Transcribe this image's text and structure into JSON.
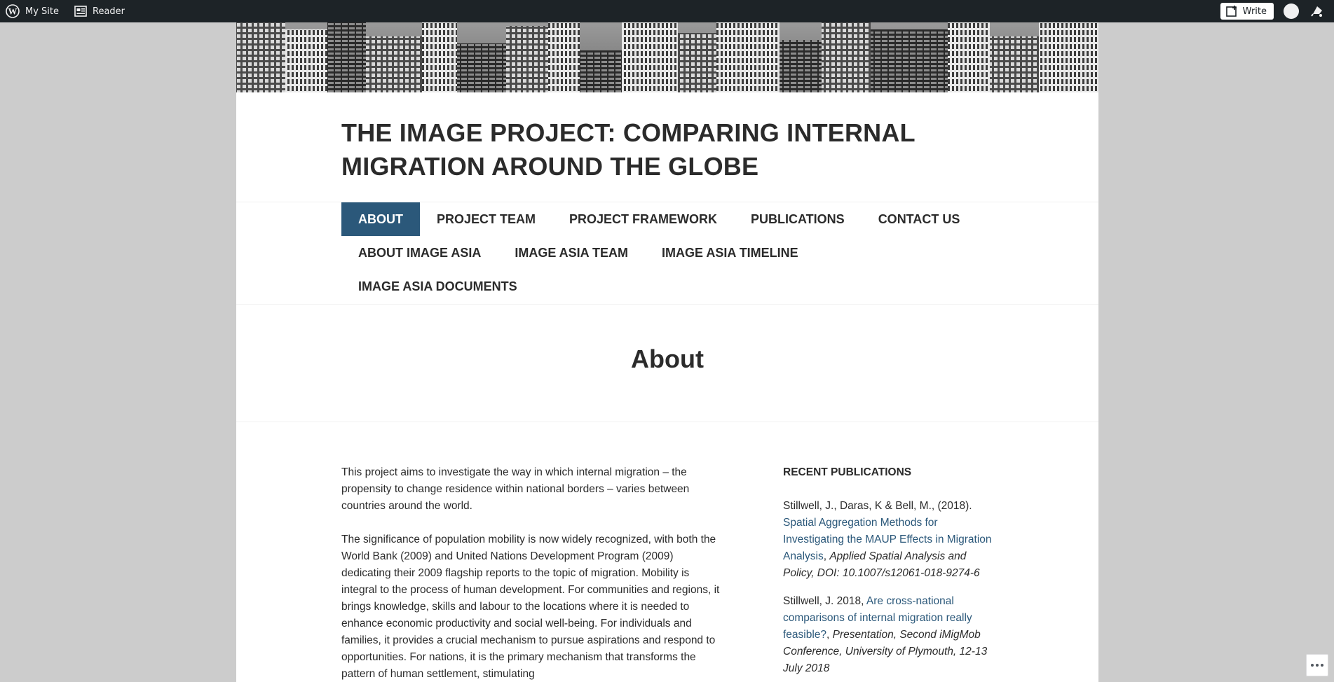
{
  "adminbar": {
    "my_site": "My Site",
    "reader": "Reader",
    "write": "Write"
  },
  "site": {
    "title": "THE IMAGE PROJECT: COMPARING INTERNAL MIGRATION AROUND THE GLOBE"
  },
  "menu": {
    "row1": [
      "ABOUT",
      "PROJECT TEAM",
      "PROJECT FRAMEWORK",
      "PUBLICATIONS",
      "CONTACT US"
    ],
    "row2": [
      "ABOUT IMAGE ASIA",
      "IMAGE ASIA TEAM",
      "IMAGE ASIA TIMELINE"
    ],
    "row3": [
      "IMAGE ASIA DOCUMENTS"
    ]
  },
  "page": {
    "title": "About",
    "paragraphs": [
      "This project aims to investigate the way in which internal migration – the propensity to change residence within national borders – varies between countries around the world.",
      "The significance of population mobility is now widely recognized, with both the World Bank (2009) and United Nations Development Program (2009) dedicating their 2009 flagship reports to the topic of migration. Mobility is integral to the process of human development. For communities and regions, it brings knowledge, skills and labour to the locations where it is needed to enhance economic productivity and social well-being. For individuals and families, it provides a crucial mechanism to pursue aspirations and respond to opportunities. For nations, it is the primary mechanism that transforms the pattern of human settlement, stimulating"
    ]
  },
  "sidebar": {
    "widget_title": "RECENT PUBLICATIONS",
    "pubs": [
      {
        "authors": "Stillwell, J., Daras, K & Bell, M., (2018).",
        "link": "Spatial Aggregation Methods for Investigating the MAUP Effects in Migration Analysis",
        "sep": ",",
        "rest": "Applied Spatial Analysis and Policy, DOI: 10.1007/s12061-018-9274-6"
      },
      {
        "authors": "Stillwell, J. 2018,",
        "link": "Are cross-national comparisons of internal migration really feasible?",
        "sep": ",",
        "rest": "Presentation, Second iMigMob Conference, University of Plymouth, 12-13 July 2018"
      }
    ]
  }
}
